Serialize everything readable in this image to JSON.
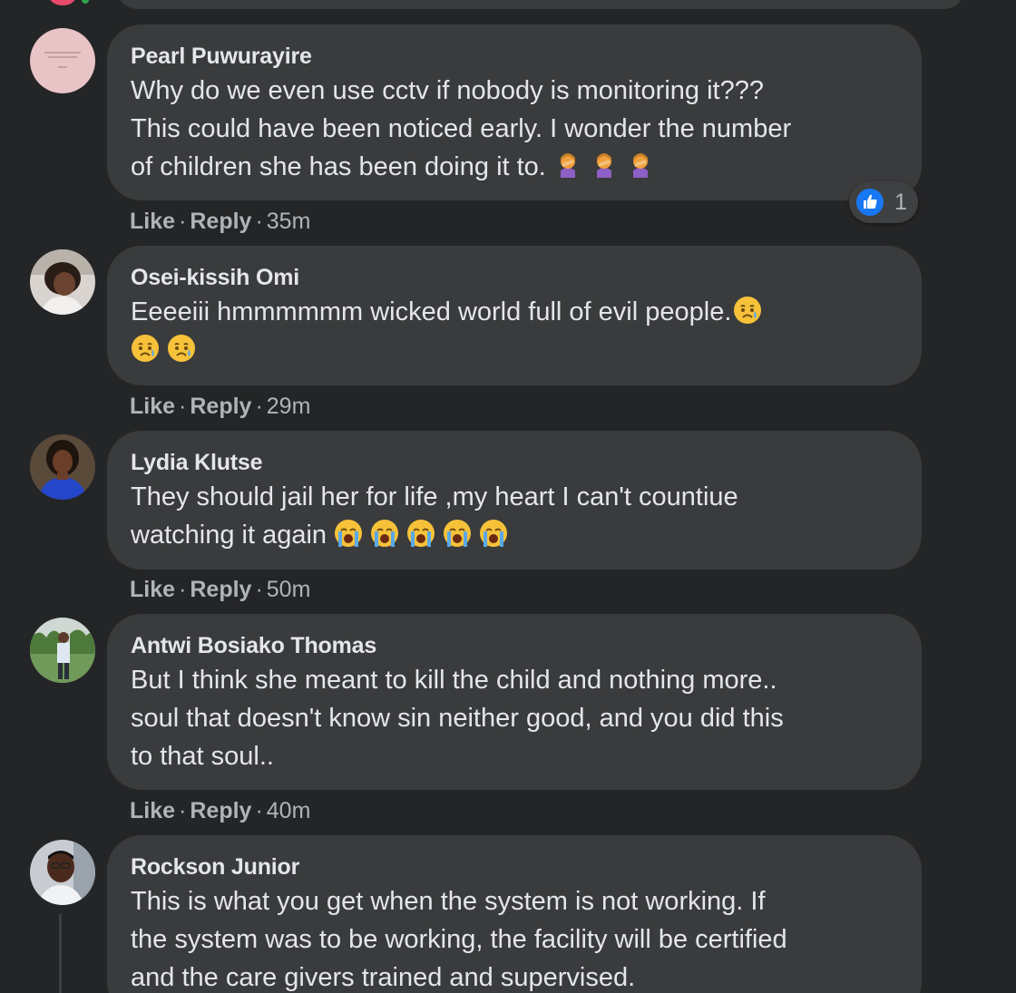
{
  "comments": [
    {
      "author": "Pearl Puwurayire",
      "lines": [
        "Why do we even use cctv if nobody is monitoring it???",
        "This could have been noticed early. I wonder the number",
        "of children she has been doing it to."
      ],
      "emoji": [
        "woman-facepalming",
        "woman-facepalming",
        "woman-facepalming"
      ],
      "actions": {
        "like": "Like",
        "reply": "Reply",
        "time": "35m"
      },
      "reaction": {
        "icon": "thumbs-up-icon",
        "count": "1"
      }
    },
    {
      "author": "Osei-kissih Omi",
      "lines": [
        "Eeeeiii hmmmmmm wicked world full of evil people."
      ],
      "emoji": [
        "sad-sweat-face",
        "sad-sweat-face",
        "sad-sweat-face"
      ],
      "actions": {
        "like": "Like",
        "reply": "Reply",
        "time": "29m"
      }
    },
    {
      "author": "Lydia Klutse",
      "lines": [
        "They should jail her for life ,my heart I can't countiue",
        "watching it again"
      ],
      "emoji": [
        "loudly-crying-face",
        "loudly-crying-face",
        "loudly-crying-face",
        "loudly-crying-face",
        "loudly-crying-face"
      ],
      "actions": {
        "like": "Like",
        "reply": "Reply",
        "time": "50m"
      }
    },
    {
      "author": "Antwi Bosiako Thomas",
      "lines": [
        "But I think she meant to kill the child and nothing more..",
        "soul that doesn't know sin neither good, and you did this",
        "to that soul.."
      ],
      "actions": {
        "like": "Like",
        "reply": "Reply",
        "time": "40m"
      }
    },
    {
      "author": "Rockson Junior",
      "lines": [
        "This is what you get when the system is not working. If",
        "the system was to be working, the facility will be certified",
        "and the care givers trained and supervised."
      ]
    }
  ],
  "colors": {
    "background": "#242526",
    "bubble": "#3a3b3c",
    "text": "#e4e6eb",
    "secondary_text": "#b0b3b8",
    "like_blue": "#1877f2"
  }
}
